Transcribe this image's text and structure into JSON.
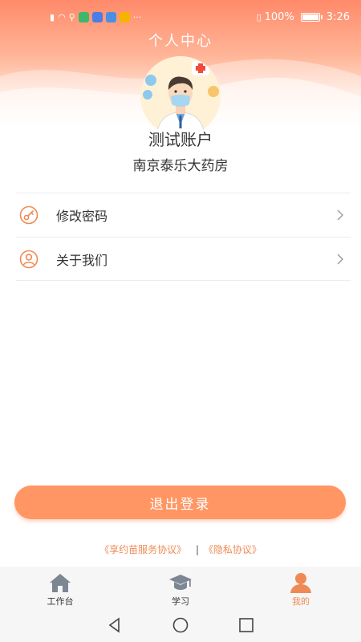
{
  "status_bar": {
    "battery": "100%",
    "time": "3:26"
  },
  "page": {
    "title": "个人中心"
  },
  "profile": {
    "account_name": "测试账户",
    "organization": "南京泰乐大药房"
  },
  "menu": [
    {
      "label": "修改密码",
      "icon": "key-icon"
    },
    {
      "label": "关于我们",
      "icon": "user-circle-icon"
    }
  ],
  "logout": {
    "label": "退出登录"
  },
  "agreements": {
    "service": "《享约苗服务协议》",
    "separator": "|",
    "privacy": "《隐私协议》"
  },
  "tabs": [
    {
      "label": "工作台",
      "icon": "home-icon",
      "active": false
    },
    {
      "label": "学习",
      "icon": "graduation-cap-icon",
      "active": false
    },
    {
      "label": "我的",
      "icon": "person-icon",
      "active": true
    }
  ],
  "colors": {
    "accent": "#ff9663",
    "accent_text": "#f08a55",
    "header_top": "#ff8a6a"
  }
}
